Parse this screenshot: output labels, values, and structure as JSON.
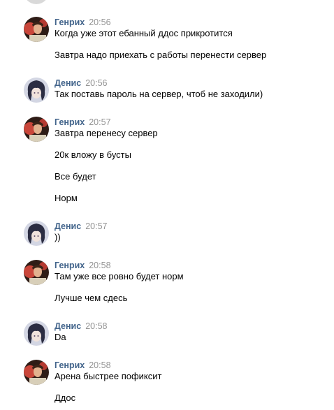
{
  "colors": {
    "author": "#42648b",
    "time": "#939393",
    "text": "#000000",
    "background": "#ffffff"
  },
  "messages": [
    {
      "author": "Генрих",
      "avatar": "henrikh-avatar",
      "time": "20:56",
      "lines": [
        "Когда уже этот ебанный ддос прикротится",
        "Завтра надо приехать с работы перенести сервер"
      ]
    },
    {
      "author": "Денис",
      "avatar": "denis-avatar",
      "time": "20:56",
      "lines": [
        "Так поставь пароль на сервер, чтоб не заходили)"
      ]
    },
    {
      "author": "Генрих",
      "avatar": "henrikh-avatar",
      "time": "20:57",
      "lines": [
        "Завтра перенесу сервер",
        "20к вложу в бусты",
        "Все будет",
        "Норм"
      ]
    },
    {
      "author": "Денис",
      "avatar": "denis-avatar",
      "time": "20:57",
      "lines": [
        "))"
      ]
    },
    {
      "author": "Генрих",
      "avatar": "henrikh-avatar",
      "time": "20:58",
      "lines": [
        "Там уже все ровно будет норм",
        "Лучше чем сдесь"
      ]
    },
    {
      "author": "Денис",
      "avatar": "denis-avatar",
      "time": "20:58",
      "lines": [
        "Da"
      ]
    },
    {
      "author": "Генрих",
      "avatar": "henrikh-avatar",
      "time": "20:58",
      "lines": [
        "Арена быстрее пофиксит",
        "Ддос"
      ]
    }
  ]
}
